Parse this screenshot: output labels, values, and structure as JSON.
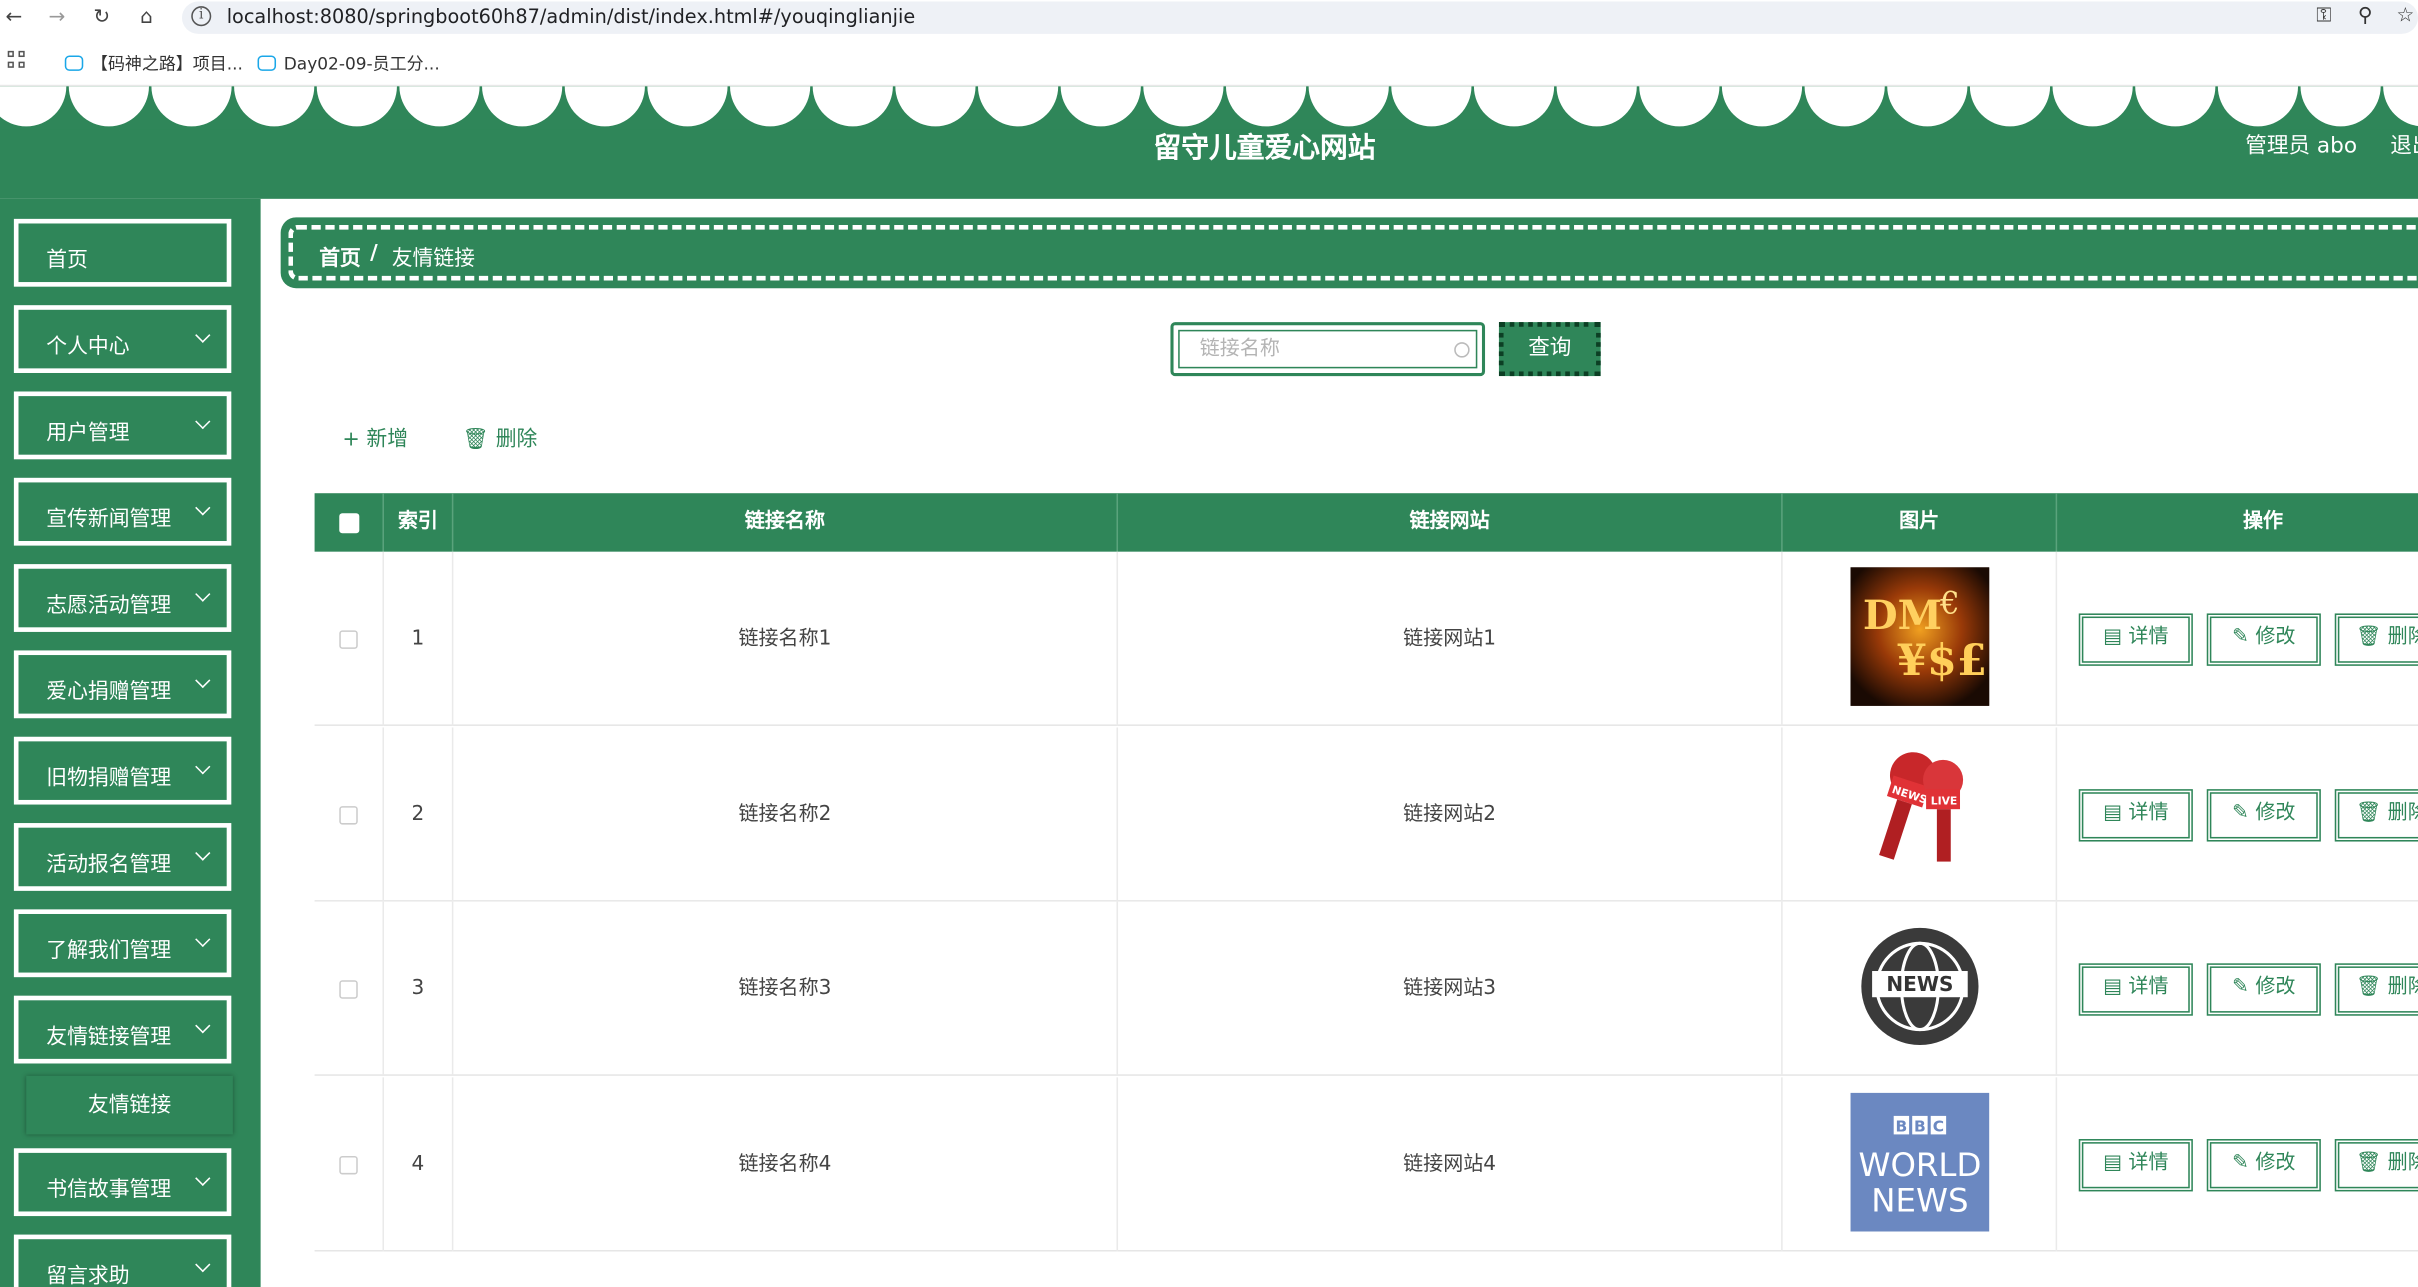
{
  "browser": {
    "url": "localhost:8080/springboot60h87/admin/dist/index.html#/youqinglianjie",
    "bookmarks": [
      "【码神之路】项目...",
      "Day02-09-员工分..."
    ]
  },
  "header": {
    "title": "留守儿童爱心网站",
    "user": "管理员 abo",
    "logout": "退出"
  },
  "sidebar": {
    "items": [
      {
        "label": "首页",
        "has_children": false
      },
      {
        "label": "个人中心",
        "has_children": true
      },
      {
        "label": "用户管理",
        "has_children": true
      },
      {
        "label": "宣传新闻管理",
        "has_children": true
      },
      {
        "label": "志愿活动管理",
        "has_children": true
      },
      {
        "label": "爱心捐赠管理",
        "has_children": true
      },
      {
        "label": "旧物捐赠管理",
        "has_children": true
      },
      {
        "label": "活动报名管理",
        "has_children": true
      },
      {
        "label": "了解我们管理",
        "has_children": true
      },
      {
        "label": "友情链接管理",
        "has_children": true
      },
      {
        "label": "书信故事管理",
        "has_children": true
      },
      {
        "label": "留言求助",
        "has_children": true
      }
    ],
    "submenu_active": "友情链接"
  },
  "breadcrumb": {
    "home": "首页",
    "separator": "/",
    "current": "友情链接"
  },
  "search": {
    "placeholder": "链接名称",
    "button": "查询"
  },
  "toolbar": {
    "add": "新增",
    "delete": "删除"
  },
  "table": {
    "columns": [
      "索引",
      "链接名称",
      "链接网站",
      "图片",
      "操作"
    ],
    "actions": [
      "详情",
      "修改",
      "删除"
    ],
    "rows": [
      {
        "index": "1",
        "name": "链接名称1",
        "site": "链接网站1",
        "image": "money-collage"
      },
      {
        "index": "2",
        "name": "链接名称2",
        "site": "链接网站2",
        "image": "news-microphones"
      },
      {
        "index": "3",
        "name": "链接名称3",
        "site": "链接网站3",
        "image": "news-globe-badge"
      },
      {
        "index": "4",
        "name": "链接名称4",
        "site": "链接网站4",
        "image": "bbc-world-news"
      }
    ]
  },
  "colors": {
    "primary": "#2f8659",
    "dark": "#0c3f24"
  }
}
